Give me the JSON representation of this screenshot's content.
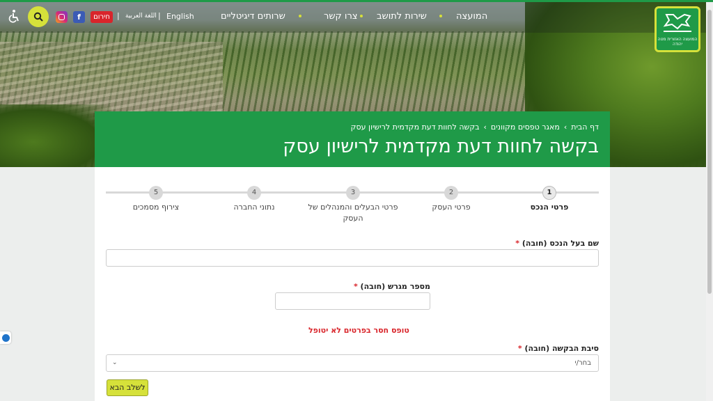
{
  "header": {
    "logo_text": "המועצה האזורית מטה יהודה",
    "nav": [
      "המועצה",
      "שירות לתושב",
      "צרו קשר",
      "שרותים דיגיטליים"
    ],
    "lang_en": "English",
    "lang_ar": "اللغة العربية",
    "separator": "|",
    "emergency": "חירום",
    "facebook": "f",
    "icons": [
      "logo-icon",
      "instagram-icon",
      "facebook-icon",
      "search-icon",
      "accessibility-icon"
    ]
  },
  "breadcrumb": {
    "items": [
      "דף הבית",
      "מאגר טפסים מקוונים",
      "בקשה לחוות דעת מקדמית לרישיון עסק"
    ],
    "separator": "›"
  },
  "page_title": "בקשה לחוות דעת מקדמית לרישיון עסק",
  "stepper": {
    "steps": [
      {
        "num": "1",
        "label": "פרטי הנכס"
      },
      {
        "num": "2",
        "label": "פרטי העסק"
      },
      {
        "num": "3",
        "label": "פרטי הבעלים והמנהלים של העסק"
      },
      {
        "num": "4",
        "label": "נתוני החברה"
      },
      {
        "num": "5",
        "label": "צירוף מסמכים"
      }
    ],
    "active": 1
  },
  "form": {
    "owner_label": "שם בעל הנכס (חובה)",
    "plot_label": "מספר מגרש (חובה)",
    "required_mark": "*",
    "error": "טופס חסר בפרטים לא יטופל",
    "reason_label": "סיבת הבקשה (חובה)",
    "reason_value": "בחר/י",
    "next_button": "לשלב הבא"
  },
  "colors": {
    "brand_green": "#1f9a48",
    "accent_yellow": "#d6e13a",
    "error_red": "#d9252b"
  }
}
